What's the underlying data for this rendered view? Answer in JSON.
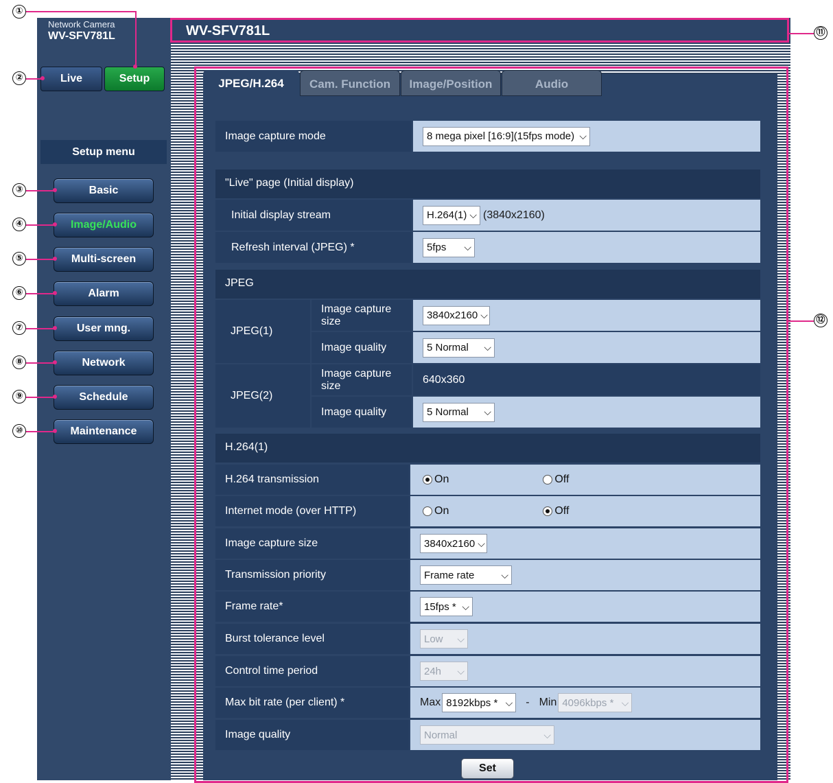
{
  "camera": {
    "subtitle": "Network Camera",
    "model": "WV-SFV781L"
  },
  "header": {
    "title": "WV-SFV781L"
  },
  "topbuttons": {
    "live": "Live",
    "setup": "Setup"
  },
  "setup_menu": "Setup menu",
  "menu": [
    "Basic",
    "Image/Audio",
    "Multi-screen",
    "Alarm",
    "User mng.",
    "Network",
    "Schedule",
    "Maintenance"
  ],
  "tabs": [
    "JPEG/H.264",
    "Cam. Function",
    "Image/Position",
    "Audio"
  ],
  "callouts": [
    "①",
    "②",
    "③",
    "④",
    "⑤",
    "⑥",
    "⑦",
    "⑧",
    "⑨",
    "⑩",
    "⑪",
    "⑫"
  ],
  "form": {
    "capture_mode": {
      "label": "Image capture mode",
      "value": "8 mega pixel [16:9](15fps mode)"
    },
    "live_section": "\"Live\" page (Initial display)",
    "initial_stream": {
      "label": "Initial display stream",
      "value": "H.264(1)",
      "note": "(3840x2160)"
    },
    "refresh": {
      "label": "Refresh interval (JPEG) *",
      "value": "5fps"
    },
    "jpeg_section": "JPEG",
    "jpeg1": {
      "label": "JPEG(1)",
      "size_label": "Image capture size",
      "size": "3840x2160",
      "quality_label": "Image quality",
      "quality": "5 Normal"
    },
    "jpeg2": {
      "label": "JPEG(2)",
      "size_label": "Image capture size",
      "size": "640x360",
      "quality_label": "Image quality",
      "quality": "5 Normal"
    },
    "h264_section": "H.264(1)",
    "h264_tx": {
      "label": "H.264 transmission",
      "on": "On",
      "off": "Off"
    },
    "internet_mode": {
      "label": "Internet mode (over HTTP)",
      "on": "On",
      "off": "Off"
    },
    "h264_size": {
      "label": "Image capture size",
      "value": "3840x2160"
    },
    "priority": {
      "label": "Transmission priority",
      "value": "Frame rate"
    },
    "frame_rate": {
      "label": "Frame rate*",
      "value": "15fps *"
    },
    "burst": {
      "label": "Burst tolerance level",
      "value": "Low"
    },
    "control_period": {
      "label": "Control time period",
      "value": "24h"
    },
    "max_bitrate": {
      "label": "Max bit rate (per client) *",
      "max_label": "Max",
      "max": "8192kbps *",
      "dash": "-",
      "min_label": "Min",
      "min": "4096kbps *"
    },
    "h264_quality": {
      "label": "Image quality",
      "value": "Normal"
    },
    "set": "Set"
  }
}
